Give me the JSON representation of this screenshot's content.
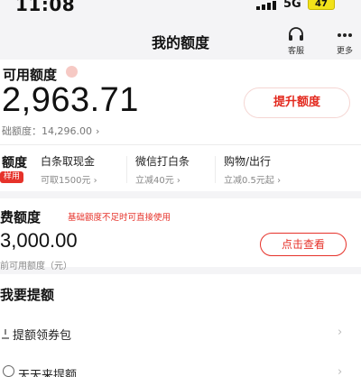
{
  "status_bar": {
    "time": "11:08",
    "network": "5G",
    "battery": "47"
  },
  "nav": {
    "title": "我的额度",
    "service_label": "客服",
    "more_label": "更多"
  },
  "credit": {
    "label": "可用额度",
    "amount": "2,963.71",
    "raise_button": "提升额度",
    "base_label": "础额度：14,296.00",
    "base_chevron": "›"
  },
  "quota": {
    "label": "额度",
    "tag": "样用",
    "items": [
      {
        "title": "白条取现金",
        "sub": "可取1500元 ›"
      },
      {
        "title": "微信打白条",
        "sub": "立减40元 ›"
      },
      {
        "title": "购物/出行",
        "sub": "立减0.5元起 ›"
      }
    ]
  },
  "consumer": {
    "label": "费额度",
    "hint": "基础额度不足时可直接使用",
    "amount": "3,000.00",
    "check_button": "点击查看",
    "sub": "前可用额度（元）"
  },
  "raise": {
    "label": "我要提额",
    "rows": [
      {
        "text": "提额领券包",
        "arrow": "›"
      },
      {
        "text": "天天来提额",
        "arrow": "›"
      }
    ]
  },
  "colors": {
    "accent": "#e6322a",
    "battery": "#f2e21a"
  }
}
